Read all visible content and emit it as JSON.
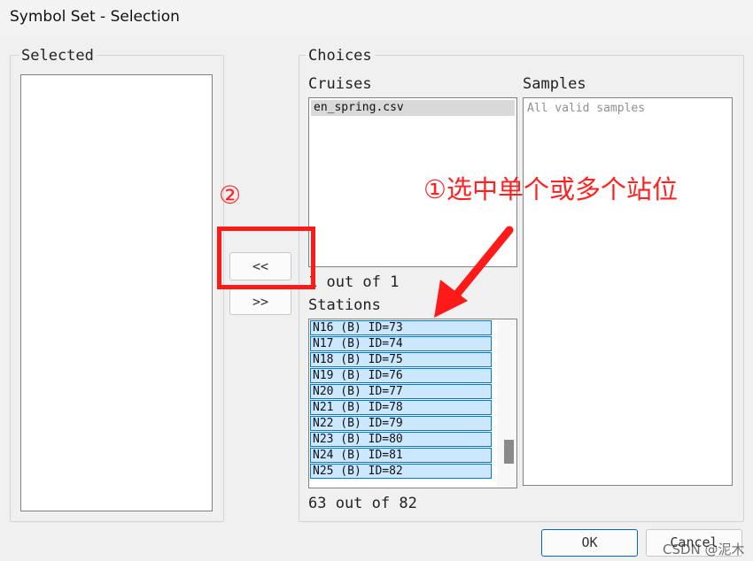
{
  "window": {
    "title": "Symbol Set - Selection"
  },
  "selected_group": {
    "label": "Selected"
  },
  "choices_group": {
    "label": "Choices"
  },
  "cruises": {
    "label": "Cruises",
    "items": [
      "en_spring.csv"
    ],
    "count_text": "1 out of 1"
  },
  "samples": {
    "label": "Samples",
    "placeholder": "All valid samples"
  },
  "stations": {
    "label": "Stations",
    "items": [
      "N16 (B) ID=73",
      "N17 (B) ID=74",
      "N18 (B) ID=75",
      "N19 (B) ID=76",
      "N20 (B) ID=77",
      "N21 (B) ID=78",
      "N22 (B) ID=79",
      "N23 (B) ID=80",
      "N24 (B) ID=81",
      "N25 (B) ID=82"
    ],
    "count_text": "63 out of 82"
  },
  "buttons": {
    "move_left": "<<",
    "move_right": ">>",
    "ok": "OK",
    "cancel": "Cancel"
  },
  "annotations": {
    "step1": "①选中单个或多个站位",
    "step2": "②",
    "watermark": "CSDN @泥木"
  },
  "colors": {
    "annotation_red": "#ff1a1a",
    "selection_blue": "#cce8ff",
    "selection_border": "#0078d7"
  }
}
